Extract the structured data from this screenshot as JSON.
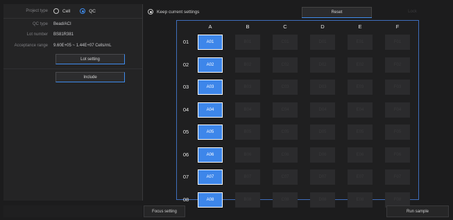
{
  "left": {
    "project_type": {
      "label": "Project type",
      "options": [
        {
          "label": "Cell",
          "selected": false
        },
        {
          "label": "QC",
          "selected": true
        }
      ]
    },
    "qc_type": {
      "label": "QC type",
      "value": "Bead/ACI"
    },
    "lot_number": {
      "label": "Lot number",
      "value": "BS81R381"
    },
    "acceptance": {
      "label": "Acceptance range",
      "value": "9.60E+05 ~ 1.44E+07 Cells/mL"
    },
    "lot_setting_label": "Lot setting",
    "include_label": "Include"
  },
  "top": {
    "keep_label": "Keep current settings",
    "reset_label": "Reset",
    "lock_label": "Lock"
  },
  "plate": {
    "columns": [
      "A",
      "B",
      "C",
      "D",
      "E",
      "F"
    ],
    "rows": [
      "01",
      "02",
      "03",
      "04",
      "05",
      "06",
      "07",
      "08"
    ],
    "wells": [
      [
        "A01",
        "B01",
        "C01",
        "D01",
        "E01",
        "F01"
      ],
      [
        "A02",
        "B02",
        "C02",
        "D02",
        "E02",
        "F02"
      ],
      [
        "A03",
        "B03",
        "C03",
        "D03",
        "E03",
        "F03"
      ],
      [
        "A04",
        "B04",
        "C04",
        "D04",
        "E04",
        "F04"
      ],
      [
        "A05",
        "B05",
        "C05",
        "D05",
        "E05",
        "F05"
      ],
      [
        "A06",
        "B06",
        "C06",
        "D06",
        "E06",
        "F06"
      ],
      [
        "A07",
        "B07",
        "C07",
        "D07",
        "E07",
        "F07"
      ],
      [
        "A08",
        "B08",
        "C08",
        "D08",
        "E08",
        "F08"
      ]
    ],
    "selected_column": "A",
    "colors": {
      "selected": "#3d86ea",
      "inactive": "#2b2b2d",
      "border": "#3f6fbd"
    }
  },
  "bottom": {
    "focus_label": "Focus setting",
    "run_label": "Run sample"
  }
}
